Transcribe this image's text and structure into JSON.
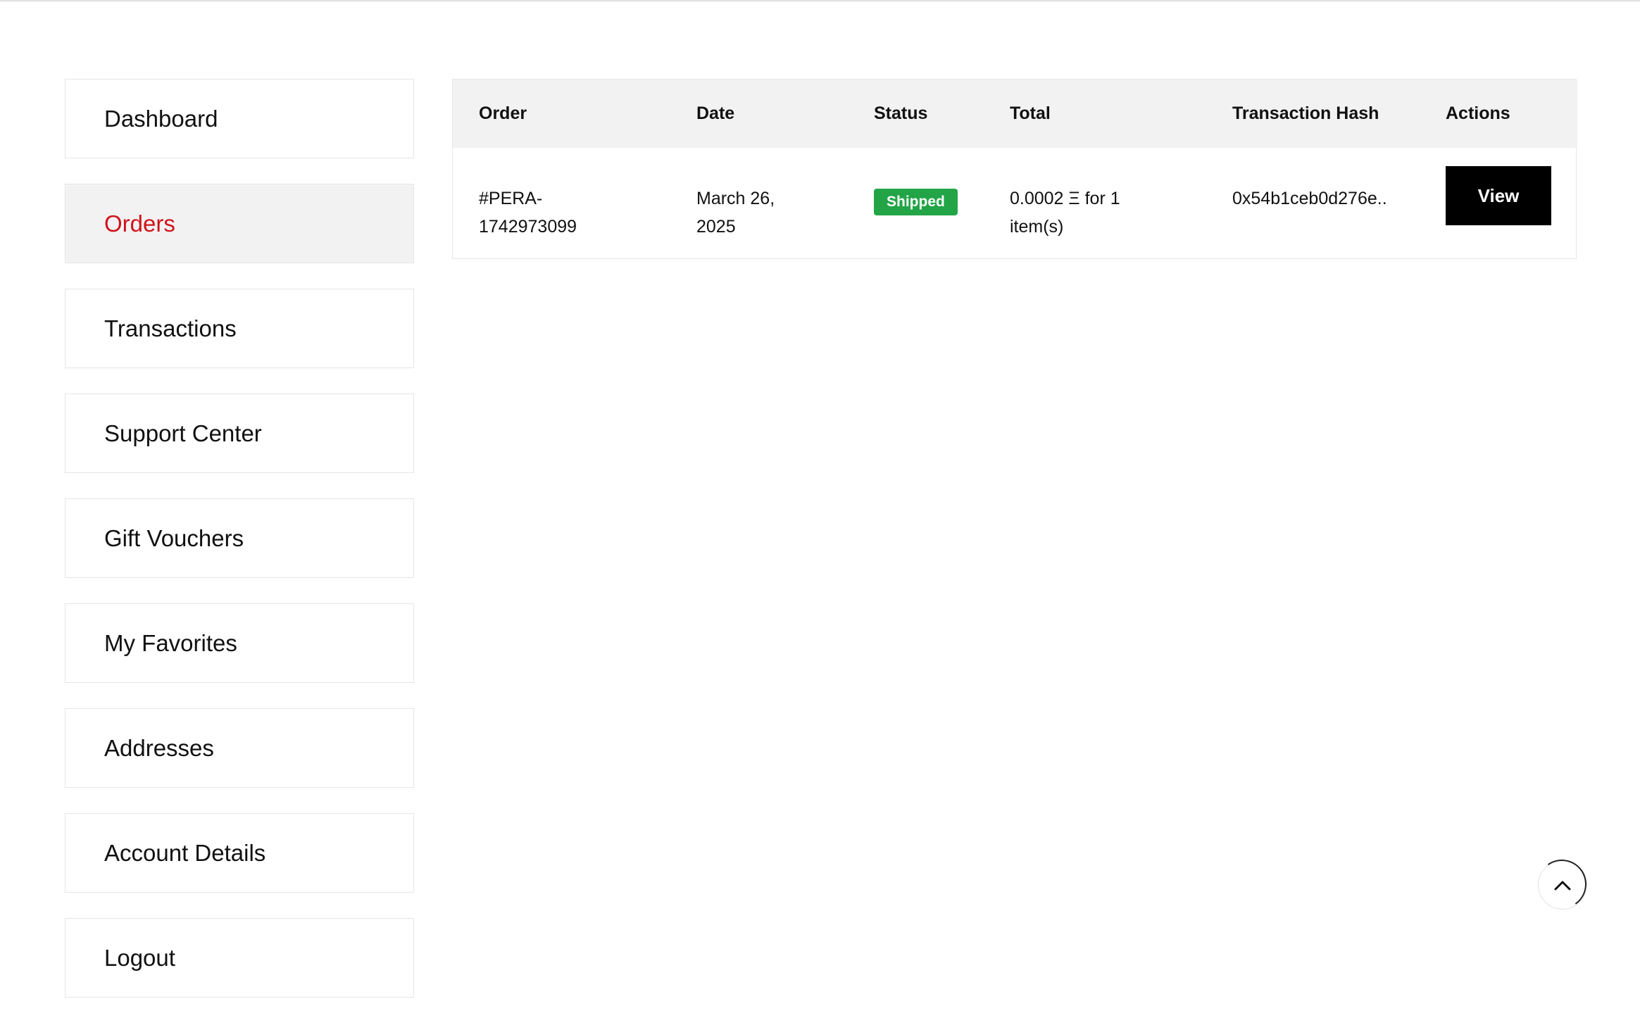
{
  "sidebar": {
    "items": [
      {
        "label": "Dashboard",
        "active": false
      },
      {
        "label": "Orders",
        "active": true
      },
      {
        "label": "Transactions",
        "active": false
      },
      {
        "label": "Support Center",
        "active": false
      },
      {
        "label": "Gift Vouchers",
        "active": false
      },
      {
        "label": "My Favorites",
        "active": false
      },
      {
        "label": "Addresses",
        "active": false
      },
      {
        "label": "Account Details",
        "active": false
      },
      {
        "label": "Logout",
        "active": false
      }
    ],
    "active_color": "#d0121b"
  },
  "orders_table": {
    "headers": {
      "order": "Order",
      "date": "Date",
      "status": "Status",
      "total": "Total",
      "hash": "Transaction Hash",
      "actions": "Actions"
    },
    "rows": [
      {
        "order_line1": "#PERA-",
        "order_line2": "1742973099",
        "date_line1": "March 26,",
        "date_line2": "2025",
        "status": "Shipped",
        "total_line1": "0.0002 Ξ for 1",
        "total_line2": "item(s)",
        "hash": "0x54b1ceb0d276e..",
        "action_label": "View"
      }
    ],
    "status_color": "#22a447"
  },
  "scroll_top": {
    "icon": "chevron-up-icon"
  }
}
